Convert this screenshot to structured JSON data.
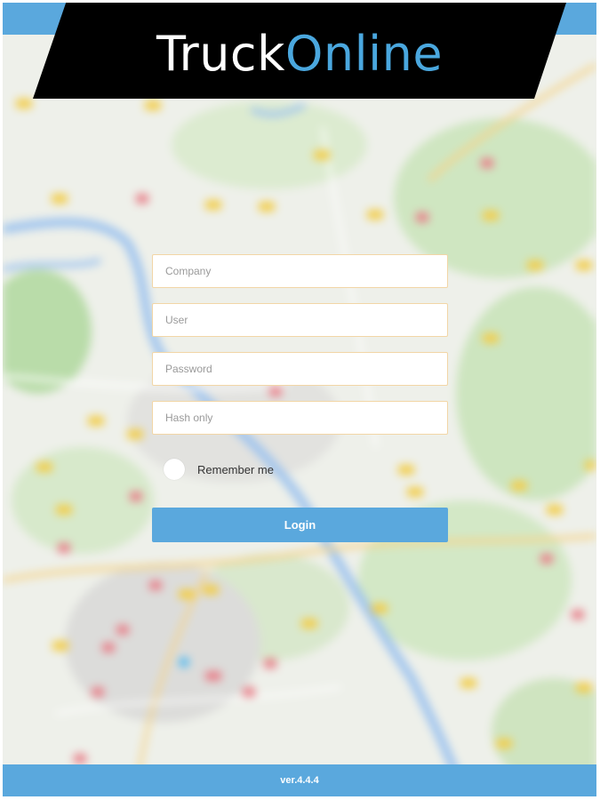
{
  "header": {
    "logo_part1": "Truck",
    "logo_part2": "Online"
  },
  "form": {
    "company_placeholder": "Company",
    "user_placeholder": "User",
    "password_placeholder": "Password",
    "hash_placeholder": "Hash only",
    "remember_label": "Remember me",
    "login_label": "Login"
  },
  "footer": {
    "version": "ver.4.4.4"
  },
  "colors": {
    "accent": "#5aa8dd",
    "logo_blue": "#4aa7de",
    "header_bg": "#000000"
  }
}
